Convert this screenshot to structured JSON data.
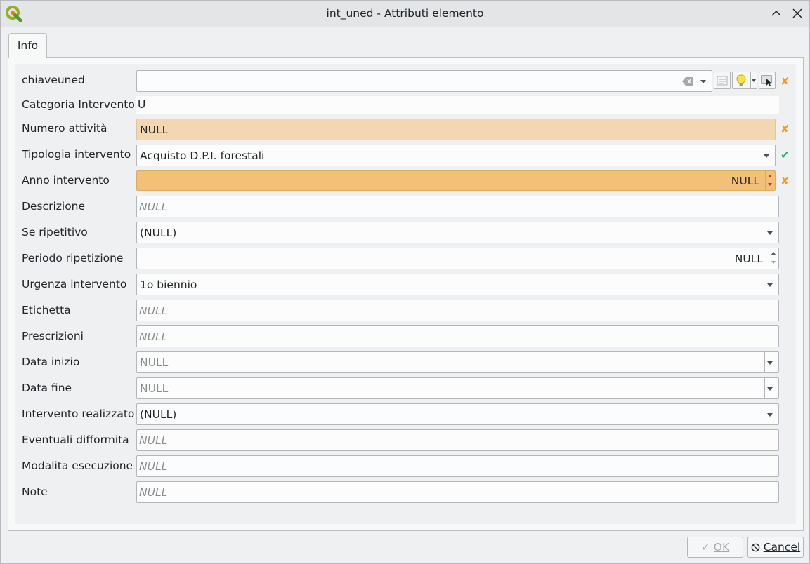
{
  "window": {
    "title": "int_uned - Attributi elemento",
    "icon": "qgis-logo-icon",
    "controls": [
      "minimize-icon",
      "close-icon"
    ]
  },
  "tabs": [
    {
      "label": "Info",
      "active": true
    }
  ],
  "fields": {
    "chiaveuned": {
      "label": "chiaveuned",
      "value": "",
      "status": "invalid"
    },
    "categoria_intervento": {
      "label": "Categoria Intervento",
      "value": "U"
    },
    "numero_attivita": {
      "label": "Numero attività",
      "value": "NULL",
      "status": "invalid"
    },
    "tipologia_intervento": {
      "label": "Tipologia intervento",
      "value": "Acquisto D.P.I. forestali",
      "status": "valid"
    },
    "anno_intervento": {
      "label": "Anno intervento",
      "value": "NULL",
      "status": "invalid"
    },
    "descrizione": {
      "label": "Descrizione",
      "placeholder": "NULL"
    },
    "se_ripetitivo": {
      "label": "Se ripetitivo",
      "value": "(NULL)"
    },
    "periodo_ripetizione": {
      "label": "Periodo ripetizione",
      "value": "NULL"
    },
    "urgenza_intervento": {
      "label": "Urgenza intervento",
      "value": "1o biennio"
    },
    "etichetta": {
      "label": "Etichetta",
      "placeholder": "NULL"
    },
    "prescrizioni": {
      "label": "Prescrizioni",
      "placeholder": "NULL"
    },
    "data_inizio": {
      "label": "Data inizio",
      "value": "NULL"
    },
    "data_fine": {
      "label": "Data fine",
      "value": "NULL"
    },
    "intervento_realizzato": {
      "label": "Intervento realizzato",
      "value": "(NULL)"
    },
    "eventuali_difformita": {
      "label": "Eventuali difformita",
      "placeholder": "NULL"
    },
    "modalita_esecuzione": {
      "label": "Modalita esecuzione",
      "placeholder": "NULL"
    },
    "note": {
      "label": "Note",
      "placeholder": "NULL"
    }
  },
  "status_marks": {
    "invalid": "✘",
    "valid": "✔"
  },
  "buttons": {
    "ok": {
      "label": "OK",
      "enabled": false
    },
    "cancel": {
      "label": "Cancel",
      "enabled": true
    }
  },
  "colors": {
    "warning_field": "#f3d6b2",
    "error_field": "#f4bf77",
    "invalid_mark": "#f39c1f",
    "valid_mark": "#27ae60"
  }
}
